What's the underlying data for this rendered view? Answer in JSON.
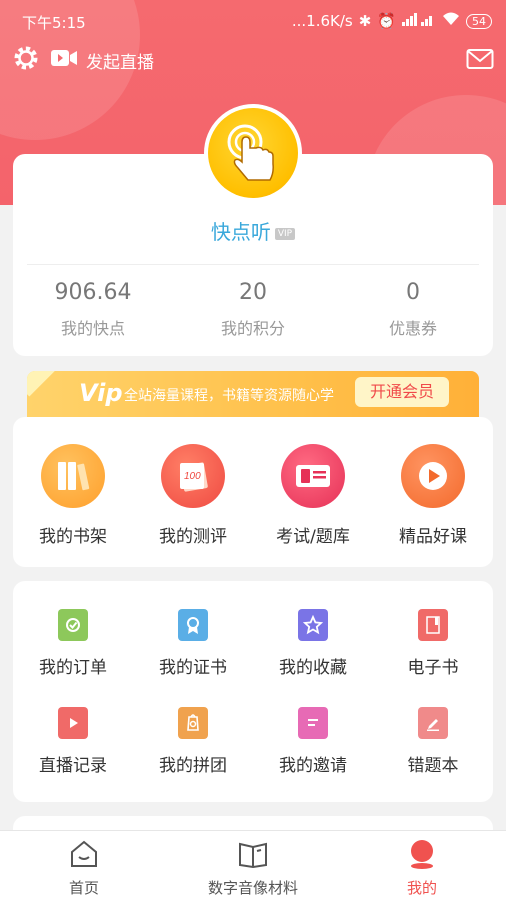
{
  "status_bar": {
    "time": "下午5:15",
    "network_speed": "...1.6K/s",
    "battery": "54"
  },
  "top_bar": {
    "live_label": "发起直播"
  },
  "profile": {
    "username": "快点听",
    "vip_badge": "VIP",
    "stats": [
      {
        "value": "906.64",
        "label": "我的快点"
      },
      {
        "value": "20",
        "label": "我的积分"
      },
      {
        "value": "0",
        "label": "优惠券"
      }
    ]
  },
  "vip_banner": {
    "word": "Vip",
    "slogan": "全站海量课程，书籍等资源随心学",
    "button": "开通会员"
  },
  "primary_menu": [
    {
      "label": "我的书架",
      "icon": "bookshelf-icon",
      "color": "#ffae3b"
    },
    {
      "label": "我的测评",
      "icon": "evaluation-icon",
      "color": "#f45b4f"
    },
    {
      "label": "考试/题库",
      "icon": "exam-icon",
      "color": "#ee3f5c"
    },
    {
      "label": "精品好课",
      "icon": "course-play-icon",
      "color": "#ff7a3d"
    }
  ],
  "secondary_menu": [
    {
      "label": "我的订单",
      "icon": "order-icon",
      "color": "#8dc85b"
    },
    {
      "label": "我的证书",
      "icon": "certificate-icon",
      "color": "#5aaee6"
    },
    {
      "label": "我的收藏",
      "icon": "star-icon",
      "color": "#7a74e6"
    },
    {
      "label": "电子书",
      "icon": "ebook-icon",
      "color": "#f06a68"
    },
    {
      "label": "直播记录",
      "icon": "live-record-icon",
      "color": "#f06a68"
    },
    {
      "label": "我的拼团",
      "icon": "group-buy-icon",
      "color": "#f0a24e"
    },
    {
      "label": "我的邀请",
      "icon": "invite-icon",
      "color": "#e76ab5"
    },
    {
      "label": "错题本",
      "icon": "wrong-book-icon",
      "color": "#f08a8a"
    }
  ],
  "bottom_nav": [
    {
      "label": "首页",
      "icon": "home-icon",
      "active": false
    },
    {
      "label": "数字音像材料",
      "icon": "book-open-icon",
      "active": false
    },
    {
      "label": "我的",
      "icon": "profile-icon",
      "active": true
    }
  ],
  "colors": {
    "header": "#f56a6f",
    "accent": "#f0524f",
    "username": "#3aa8db"
  }
}
